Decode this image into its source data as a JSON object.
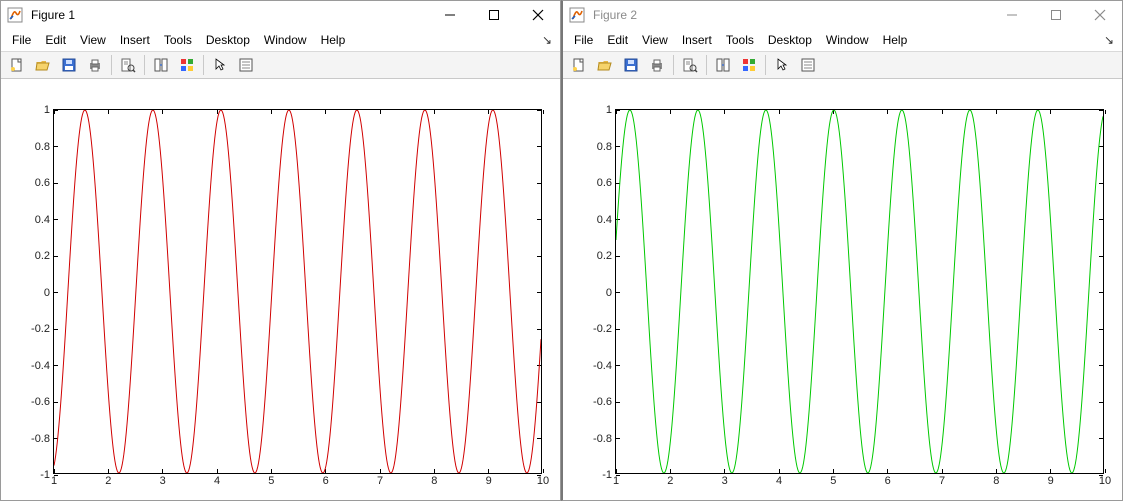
{
  "windows": [
    {
      "title": "Figure 1",
      "active": true,
      "menus": [
        "File",
        "Edit",
        "View",
        "Insert",
        "Tools",
        "Desktop",
        "Window",
        "Help"
      ],
      "axes": {
        "xlim": [
          1,
          10
        ],
        "ylim": [
          -1,
          1
        ],
        "xticks": [
          1,
          2,
          3,
          4,
          5,
          6,
          7,
          8,
          9,
          10
        ],
        "yticks": [
          -1,
          -0.8,
          -0.6,
          -0.4,
          -0.2,
          0,
          0.2,
          0.4,
          0.6,
          0.8,
          1
        ]
      },
      "chart": {
        "curve": "sin",
        "freq": 5,
        "color": "#d00000"
      }
    },
    {
      "title": "Figure 2",
      "active": false,
      "menus": [
        "File",
        "Edit",
        "View",
        "Insert",
        "Tools",
        "Desktop",
        "Window",
        "Help"
      ],
      "axes": {
        "xlim": [
          1,
          10
        ],
        "ylim": [
          -1,
          1
        ],
        "xticks": [
          1,
          2,
          3,
          4,
          5,
          6,
          7,
          8,
          9,
          10
        ],
        "yticks": [
          -1,
          -0.8,
          -0.6,
          -0.4,
          -0.2,
          0,
          0.2,
          0.4,
          0.6,
          0.8,
          1
        ]
      },
      "chart": {
        "curve": "cos",
        "freq": 5,
        "color": "#00c800"
      }
    }
  ],
  "toolbar_icons": [
    "new",
    "open",
    "save",
    "print",
    "|",
    "print-preview",
    "|",
    "link",
    "palette",
    "|",
    "pointer",
    "data-cursor"
  ],
  "chart_data": [
    {
      "figure": "Figure 1",
      "type": "line",
      "function": "y = sin(5*x)",
      "x_range": [
        1,
        10
      ],
      "color": "#d00000",
      "xlim": [
        1,
        10
      ],
      "ylim": [
        -1,
        1
      ],
      "xticks": [
        1,
        2,
        3,
        4,
        5,
        6,
        7,
        8,
        9,
        10
      ],
      "yticks": [
        -1,
        -0.8,
        -0.6,
        -0.4,
        -0.2,
        0,
        0.2,
        0.4,
        0.6,
        0.8,
        1
      ]
    },
    {
      "figure": "Figure 2",
      "type": "line",
      "function": "y = cos(5*x)",
      "x_range": [
        1,
        10
      ],
      "color": "#00c800",
      "xlim": [
        1,
        10
      ],
      "ylim": [
        -1,
        1
      ],
      "xticks": [
        1,
        2,
        3,
        4,
        5,
        6,
        7,
        8,
        9,
        10
      ],
      "yticks": [
        -1,
        -0.8,
        -0.6,
        -0.4,
        -0.2,
        0,
        0.2,
        0.4,
        0.6,
        0.8,
        1
      ]
    }
  ]
}
